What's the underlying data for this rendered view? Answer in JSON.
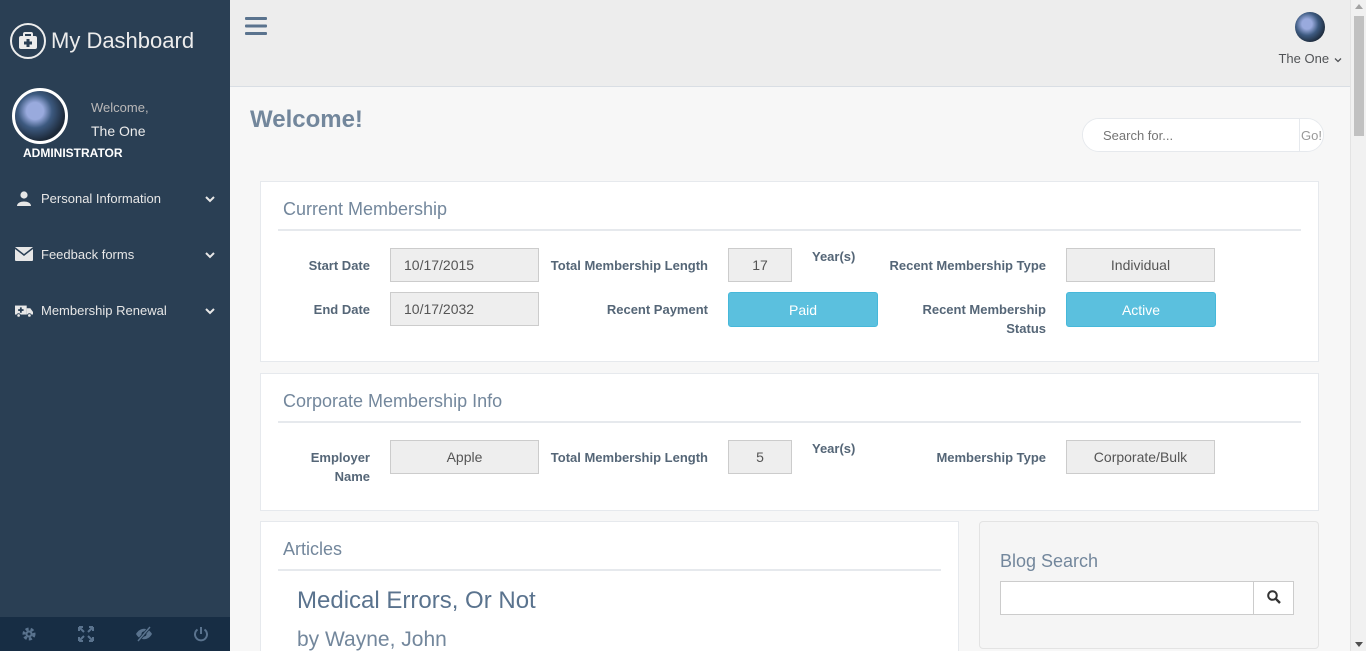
{
  "app": {
    "title": "My Dashboard"
  },
  "sidebar": {
    "welcome": "Welcome,",
    "user_name": "The One",
    "role": "ADMINISTRATOR",
    "menu": [
      {
        "label": "Personal Information",
        "icon": "user-icon"
      },
      {
        "label": "Feedback forms",
        "icon": "envelope-icon"
      },
      {
        "label": "Membership Renewal",
        "icon": "ambulance-icon"
      }
    ],
    "footer_icons": [
      "gear-icon",
      "fullscreen-icon",
      "eye-slash-icon",
      "power-icon"
    ]
  },
  "topnav": {
    "user_label": "The One"
  },
  "page": {
    "title": "Welcome!"
  },
  "search": {
    "placeholder": "Search for...",
    "button": "Go!"
  },
  "current_membership": {
    "title": "Current Membership",
    "start_date_label": "Start Date",
    "start_date": "10/17/2015",
    "end_date_label": "End Date",
    "end_date": "10/17/2032",
    "total_length_label": "Total Membership Length",
    "total_length": "17",
    "years_label": "Year(s)",
    "recent_payment_label": "Recent Payment",
    "recent_payment": "Paid",
    "recent_type_label": "Recent Membership Type",
    "recent_type": "Individual",
    "recent_status_label_1": "Recent Membership",
    "recent_status_label_2": "Status",
    "recent_status": "Active"
  },
  "corporate_membership": {
    "title": "Corporate Membership Info",
    "employer_label_1": "Employer",
    "employer_label_2": "Name",
    "employer": "Apple",
    "total_length_label": "Total Membership Length",
    "total_length": "5",
    "years_label": "Year(s)",
    "type_label": "Membership Type",
    "type": "Corporate/Bulk"
  },
  "articles": {
    "title": "Articles",
    "items": [
      {
        "title": "Medical Errors, Or Not",
        "byline": "by Wayne, John"
      }
    ]
  },
  "blog_search": {
    "title": "Blog Search",
    "placeholder": ""
  },
  "colors": {
    "sidebar": "#2a3f54",
    "info": "#5bc0de",
    "topnav": "#ededed"
  }
}
